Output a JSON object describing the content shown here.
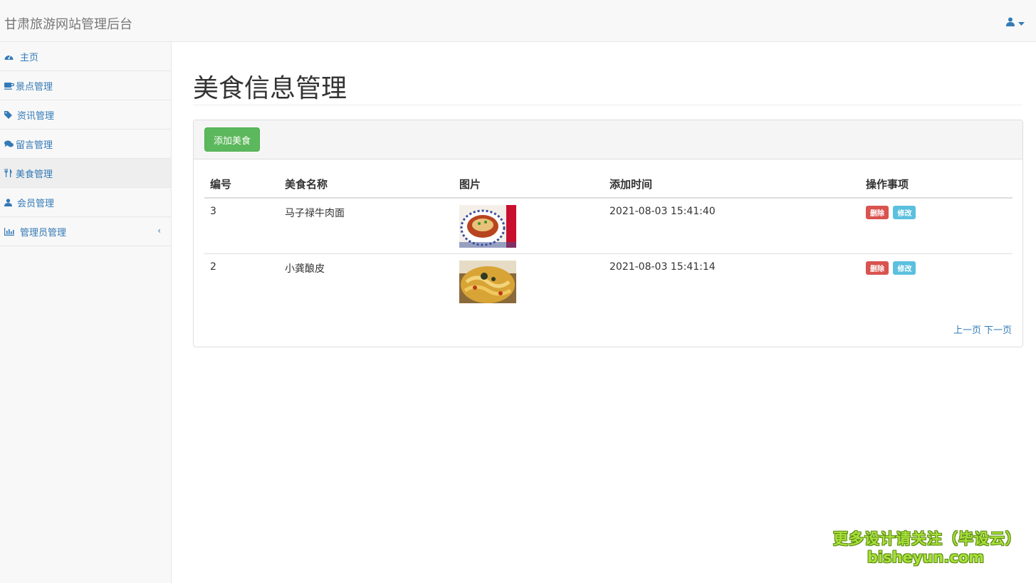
{
  "header": {
    "brand": "甘肃旅游网站管理后台",
    "user_icon": "user-icon"
  },
  "sidebar": {
    "items": [
      {
        "label": "主页",
        "icon": "dashboard-icon"
      },
      {
        "label": "景点管理",
        "icon": "coffee-icon"
      },
      {
        "label": "资讯管理",
        "icon": "tag-icon"
      },
      {
        "label": "留言管理",
        "icon": "comments-icon"
      },
      {
        "label": "美食管理",
        "icon": "cutlery-icon"
      },
      {
        "label": "会员管理",
        "icon": "user-icon"
      },
      {
        "label": "管理员管理",
        "icon": "bar-chart-icon"
      }
    ]
  },
  "main": {
    "title": "美食信息管理",
    "add_button": "添加美食",
    "columns": [
      "编号",
      "美食名称",
      "图片",
      "添加时间",
      "操作事项"
    ],
    "rows": [
      {
        "id": "3",
        "name": "马子禄牛肉面",
        "time": "2021-08-03 15:41:40",
        "delete": "删除",
        "edit": "修改"
      },
      {
        "id": "2",
        "name": "小龚酿皮",
        "time": "2021-08-03 15:41:14",
        "delete": "删除",
        "edit": "修改"
      }
    ],
    "pager": {
      "prev": "上一页",
      "next": "下一页"
    }
  },
  "watermark": {
    "line1": "更多设计请关注（毕设云）",
    "line2": "bisheyun.com"
  },
  "colors": {
    "link": "#337ab7",
    "success": "#5cb85c",
    "danger": "#d9534f",
    "info": "#5bc0de"
  }
}
